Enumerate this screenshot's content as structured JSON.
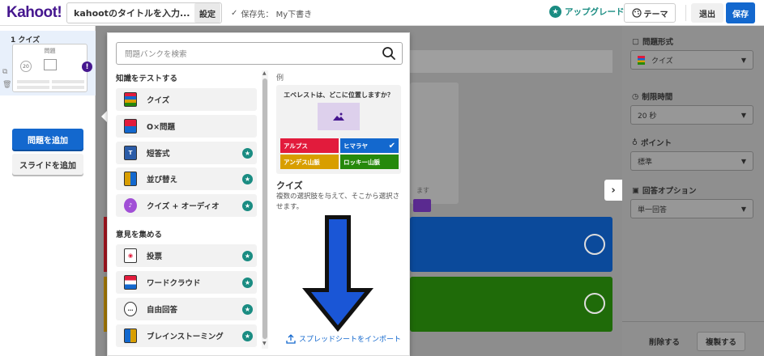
{
  "header": {
    "logo": "Kahoot!",
    "title_value": "kahootのタイトルを入力...",
    "settings_label": "設定",
    "saved_label": "保存先： My下書き",
    "upgrade_label": "アップグレード",
    "theme_label": "テーマ",
    "exit_label": "退出",
    "save_label": "保存"
  },
  "sidebar": {
    "slide_number": "1",
    "slide_type": "クイズ",
    "thumb_title": "問題",
    "thumb_timer": "20",
    "warn": "!",
    "add_question": "問題を追加",
    "add_slide": "スライドを追加"
  },
  "modal": {
    "search_placeholder": "問題バンクを検索",
    "group_test": "知識をテストする",
    "group_opinion": "意見を集める",
    "test_types": [
      {
        "label": "クイズ",
        "premium": false
      },
      {
        "label": "O×問題",
        "premium": false
      },
      {
        "label": "短答式",
        "premium": true
      },
      {
        "label": "並び替え",
        "premium": true
      },
      {
        "label": "クイズ + オーディオ",
        "premium": true
      }
    ],
    "opinion_types": [
      {
        "label": "投票",
        "premium": true
      },
      {
        "label": "ワードクラウド",
        "premium": true
      },
      {
        "label": "自由回答",
        "premium": true
      },
      {
        "label": "ブレインストーミング",
        "premium": true
      }
    ],
    "example_label": "例",
    "example_question": "エベレストは、どこに位置しますか？",
    "example_answers": [
      "アルプス",
      "ヒマラヤ",
      "アンデス山脈",
      "ロッキー山脈"
    ],
    "example_title": "クイズ",
    "example_desc": "複数の選択肢を与えて、そこから選択させます。",
    "import_label": "スプレッドシートをインポート"
  },
  "canvas": {
    "hint": "ます"
  },
  "right_panel": {
    "question_type_label": "問題形式",
    "question_type_value": "クイズ",
    "time_limit_label": "制限時間",
    "time_limit_value": "20 秒",
    "points_label": "ポイント",
    "points_value": "標準",
    "answer_options_label": "回答オプション",
    "answer_options_value": "単一回答",
    "delete_label": "削除する",
    "duplicate_label": "複製する"
  },
  "colors": {
    "kahoot_purple": "#46178f",
    "primary_blue": "#1368ce",
    "teal_premium": "#1a8c82",
    "red": "#e21b3c",
    "blue": "#1368ce",
    "yellow": "#d89e00",
    "green": "#26890c"
  }
}
